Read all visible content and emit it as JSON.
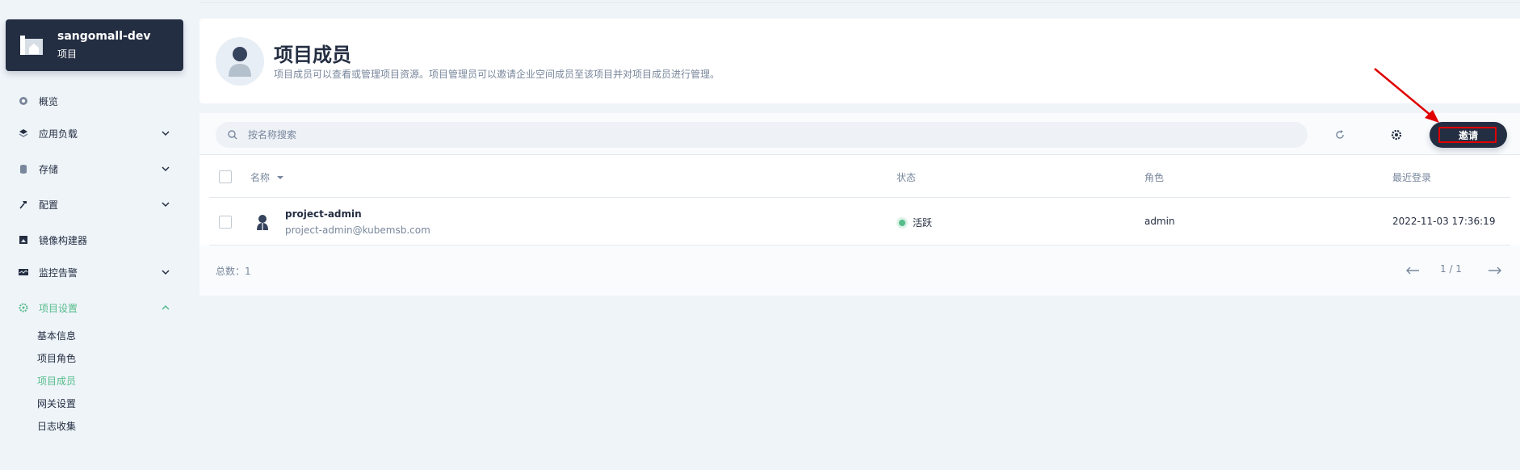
{
  "project": {
    "name": "sangomall-dev",
    "type": "项目"
  },
  "nav": {
    "overview": "概览",
    "workloads": "应用负载",
    "storage": "存储",
    "config": "配置",
    "image_builder": "镜像构建器",
    "monitoring": "监控告警",
    "project_settings": "项目设置",
    "sub": [
      "基本信息",
      "项目角色",
      "项目成员",
      "网关设置",
      "日志收集"
    ]
  },
  "header": {
    "title": "项目成员",
    "description": "项目成员可以查看或管理项目资源。项目管理员可以邀请企业空间成员至该项目并对项目成员进行管理。"
  },
  "toolbar": {
    "search_placeholder": "按名称搜索",
    "invite_label": "邀请"
  },
  "table": {
    "columns": {
      "name": "名称",
      "status": "状态",
      "role": "角色",
      "last_login": "最近登录"
    },
    "rows": [
      {
        "name": "project-admin",
        "email": "project-admin@kubemsb.com",
        "status": "活跃",
        "role": "admin",
        "last_login": "2022-11-03 17:36:19"
      }
    ]
  },
  "footer": {
    "total": "总数：1",
    "page": "1 / 1"
  },
  "colors": {
    "accent": "#55bc8a",
    "dark": "#242e42",
    "annotation": "#e00000"
  }
}
